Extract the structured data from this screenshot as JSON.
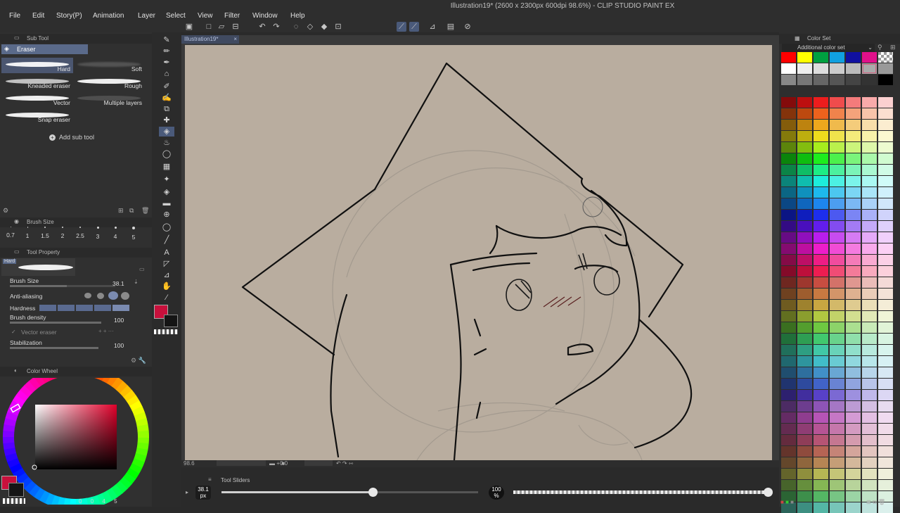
{
  "window_title": "Illustration19* (2600 x 2300px 600dpi 98.6%) - CLIP STUDIO PAINT EX",
  "menu": [
    "File",
    "Edit",
    "Story(P)",
    "Animation",
    "Layer",
    "Select",
    "View",
    "Filter",
    "Window",
    "Help"
  ],
  "sub_tool": {
    "header": "Sub Tool",
    "group": "Eraser",
    "brushes": [
      "Hard",
      "Soft",
      "Kneaded eraser",
      "Rough",
      "Vector",
      "Multiple layers",
      "Snap eraser"
    ],
    "selected": "Hard",
    "add_label": "Add sub tool"
  },
  "brush_size_panel": {
    "header": "Brush Size",
    "sizes": [
      "0.7",
      "1",
      "1.5",
      "2",
      "2.5",
      "3",
      "4",
      "5"
    ]
  },
  "tool_property": {
    "header": "Tool Property",
    "preset_name": "Hard",
    "brush_size_label": "Brush Size",
    "brush_size_value": "38.1",
    "anti_aliasing_label": "Anti-aliasing",
    "hardness_label": "Hardness",
    "brush_density_label": "Brush density",
    "brush_density_value": "100",
    "vector_eraser_label": "Vector eraser",
    "stabilization_label": "Stabilization",
    "stabilization_value": "100"
  },
  "color_wheel": {
    "header": "Color Wheel",
    "main_color": "#c8103c",
    "sub_color": "#151515",
    "footer": [
      "0",
      "0",
      "4",
      "5"
    ]
  },
  "canvas": {
    "tab": "Illustration19*",
    "zoom": "98.6",
    "angle": "0.0"
  },
  "tool_sliders": {
    "header": "Tool Sliders",
    "size_value": "38.1",
    "size_unit": "px",
    "size_fraction": 0.59,
    "opacity_value": "100",
    "opacity_unit": "%",
    "opacity_fraction": 1.0
  },
  "color_set": {
    "header": "Color Set",
    "set_name": "Additional color set",
    "rows": [
      [
        "#ff0000",
        "#ffff00",
        "#00a040",
        "#10a0e0",
        "#1010a0",
        "#e0108a",
        "#ffffff"
      ],
      [
        "#ffffff",
        "#eeeeee",
        "#dddddd",
        "#cccccc",
        "#bbbbbb",
        "#aaaaaa",
        "#999999"
      ],
      [
        "#888888",
        "#777777",
        "#666666",
        "#555555",
        "#444444",
        "#333333",
        "#000000"
      ]
    ],
    "gradient_hues": [
      "#6a0000",
      "#6a2000",
      "#6a4a00",
      "#6a6a00",
      "#3a6a00",
      "#006a10",
      "#006a50",
      "#005a6a",
      "#00306a",
      "#00106a",
      "#20006a",
      "#50006a",
      "#6a0050",
      "#6a0020",
      "#6a1010",
      "#6a3010",
      "#6a5020",
      "#4a6020",
      "#206030",
      "#106050",
      "#105a60",
      "#103060",
      "#301060",
      "#601050",
      "#502020",
      "#504020",
      "#405030",
      "#205040",
      "#204050",
      "#302050",
      "#502040",
      "#503030",
      "#505030",
      "#305030",
      "#304040",
      "#303040",
      "#403040"
    ]
  }
}
